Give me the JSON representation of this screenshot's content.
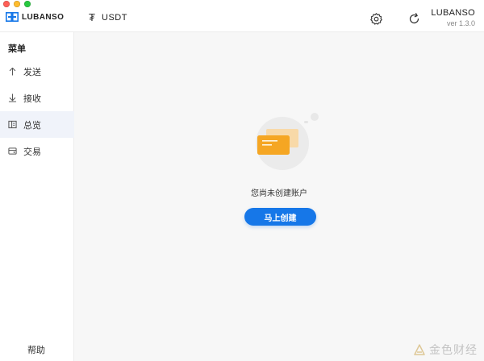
{
  "header": {
    "logo_text": "LUBANSO",
    "currency_symbol": "₮",
    "currency_label": "USDT",
    "app_name": "LUBANSO",
    "app_version": "ver 1.3.0",
    "icons": [
      "settings-icon",
      "refresh-icon"
    ]
  },
  "sidebar": {
    "menu_title": "菜单",
    "items": [
      {
        "label": "发送",
        "icon": "upload-arrow-icon",
        "active": false
      },
      {
        "label": "接收",
        "icon": "download-arrow-icon",
        "active": false
      },
      {
        "label": "总览",
        "icon": "overview-icon",
        "active": true
      },
      {
        "label": "交易",
        "icon": "transaction-icon",
        "active": false
      }
    ],
    "help_label": "帮助"
  },
  "main": {
    "empty_message": "您尚未创建账户",
    "create_button_label": "马上创建"
  },
  "watermark": {
    "text": "金色财经"
  },
  "colors": {
    "accent": "#1677e8",
    "active_nav_bg": "#f0f3fa",
    "main_bg": "#f7f7f7",
    "card_orange": "#f5a623"
  }
}
